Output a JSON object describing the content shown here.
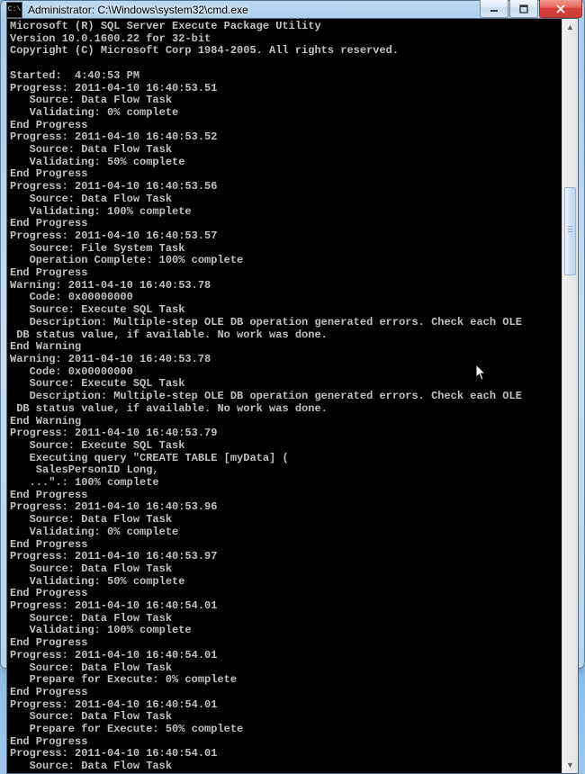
{
  "window": {
    "title": "Administrator: C:\\Windows\\system32\\cmd.exe",
    "icon_glyph": "C:\\"
  },
  "console": {
    "lines": [
      "Microsoft (R) SQL Server Execute Package Utility",
      "Version 10.0.1600.22 for 32-bit",
      "Copyright (C) Microsoft Corp 1984-2005. All rights reserved.",
      "",
      "Started:  4:40:53 PM",
      "Progress: 2011-04-10 16:40:53.51",
      "   Source: Data Flow Task",
      "   Validating: 0% complete",
      "End Progress",
      "Progress: 2011-04-10 16:40:53.52",
      "   Source: Data Flow Task",
      "   Validating: 50% complete",
      "End Progress",
      "Progress: 2011-04-10 16:40:53.56",
      "   Source: Data Flow Task",
      "   Validating: 100% complete",
      "End Progress",
      "Progress: 2011-04-10 16:40:53.57",
      "   Source: File System Task",
      "   Operation Complete: 100% complete",
      "End Progress",
      "Warning: 2011-04-10 16:40:53.78",
      "   Code: 0x00000000",
      "   Source: Execute SQL Task",
      "   Description: Multiple-step OLE DB operation generated errors. Check each OLE",
      " DB status value, if available. No work was done.",
      "End Warning",
      "Warning: 2011-04-10 16:40:53.78",
      "   Code: 0x00000000",
      "   Source: Execute SQL Task",
      "   Description: Multiple-step OLE DB operation generated errors. Check each OLE",
      " DB status value, if available. No work was done.",
      "End Warning",
      "Progress: 2011-04-10 16:40:53.79",
      "   Source: Execute SQL Task",
      "   Executing query \"CREATE TABLE [myData] (",
      "    SalesPersonID Long,",
      "   ...\".: 100% complete",
      "End Progress",
      "Progress: 2011-04-10 16:40:53.96",
      "   Source: Data Flow Task",
      "   Validating: 0% complete",
      "End Progress",
      "Progress: 2011-04-10 16:40:53.97",
      "   Source: Data Flow Task",
      "   Validating: 50% complete",
      "End Progress",
      "Progress: 2011-04-10 16:40:54.01",
      "   Source: Data Flow Task",
      "   Validating: 100% complete",
      "End Progress",
      "Progress: 2011-04-10 16:40:54.01",
      "   Source: Data Flow Task",
      "   Prepare for Execute: 0% complete",
      "End Progress",
      "Progress: 2011-04-10 16:40:54.01",
      "   Source: Data Flow Task",
      "   Prepare for Execute: 50% complete",
      "End Progress",
      "Progress: 2011-04-10 16:40:54.01",
      "   Source: Data Flow Task"
    ]
  }
}
